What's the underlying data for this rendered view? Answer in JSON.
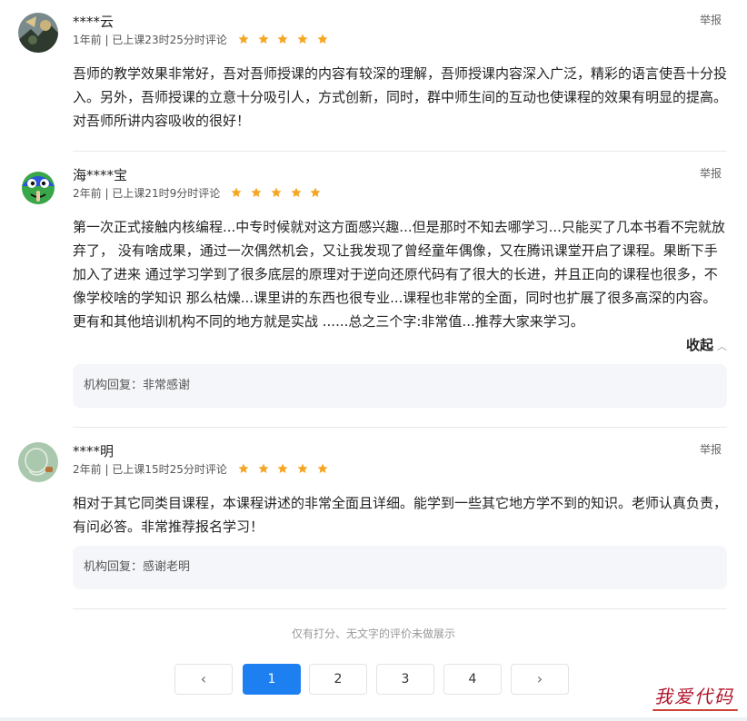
{
  "reviews": [
    {
      "username": "****云",
      "meta": "1年前 | 已上课23时25分时评论",
      "stars": 5,
      "report_label": "举报",
      "content": "吾师的教学效果非常好，吾对吾师授课的内容有较深的理解，吾师授课内容深入广泛，精彩的语言使吾十分投入。另外，吾师授课的立意十分吸引人，方式创新，同时，群中师生间的互动也使课程的效果有明显的提高。对吾师所讲内容吸收的很好！"
    },
    {
      "username": "海****宝",
      "meta": "2年前 | 已上课21时9分时评论",
      "stars": 5,
      "report_label": "举报",
      "content": "第一次正式接触内核编程...中专时候就对这方面感兴趣...但是那时不知去哪学习...只能买了几本书看不完就放弃了， 没有啥成果，通过一次偶然机会，又让我发现了曾经童年偶像，又在腾讯课堂开启了课程。果断下手加入了进来 通过学习学到了很多底层的原理对于逆向还原代码有了很大的长进，并且正向的课程也很多，不像学校啥的学知识 那么枯燥...课里讲的东西也很专业...课程也非常的全面，同时也扩展了很多高深的内容。更有和其他培训机构不同的地方就是实战 ......总之三个字:非常值...推荐大家来学习。",
      "collapse_label": "收起",
      "reply": "机构回复：非常感谢"
    },
    {
      "username": "****明",
      "meta": "2年前 | 已上课15时25分时评论",
      "stars": 5,
      "report_label": "举报",
      "content": "相对于其它同类目课程，本课程讲述的非常全面且详细。能学到一些其它地方学不到的知识。老师认真负责，有问必答。非常推荐报名学习！",
      "reply": "机构回复：感谢老明"
    }
  ],
  "footnote": "仅有打分、无文字的评价未做展示",
  "pagination": {
    "prev_icon": "chevron-left-icon",
    "next_icon": "chevron-right-icon",
    "pages": [
      "1",
      "2",
      "3",
      "4"
    ],
    "current": "1"
  },
  "watermark": "我爱代码",
  "colors": {
    "star": "#f5a623",
    "accent": "#1e7ff1",
    "reply_bg": "#f4f6f9"
  }
}
